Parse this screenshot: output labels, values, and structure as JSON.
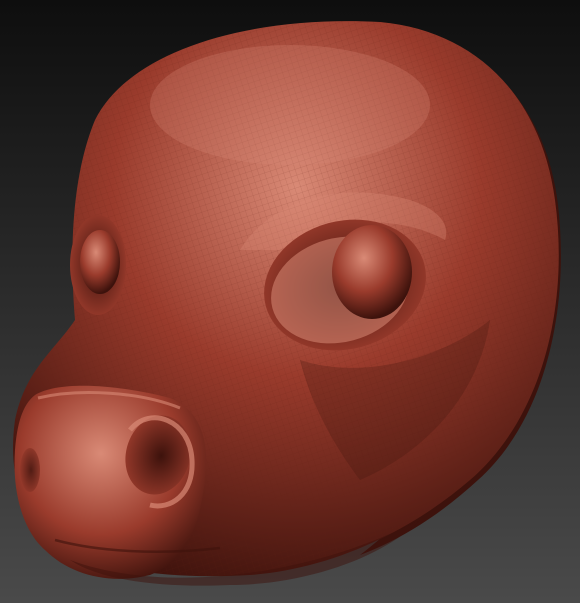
{
  "scene": {
    "description_free": true,
    "background": {
      "top_color": "#0e0e0e",
      "bottom_color": "#4a4a4a"
    },
    "material": {
      "base_color": "#9a3b2c",
      "highlight_color": "#d98a76",
      "shadow_color": "#3d120c",
      "wire_color": "#5e1c12"
    }
  }
}
